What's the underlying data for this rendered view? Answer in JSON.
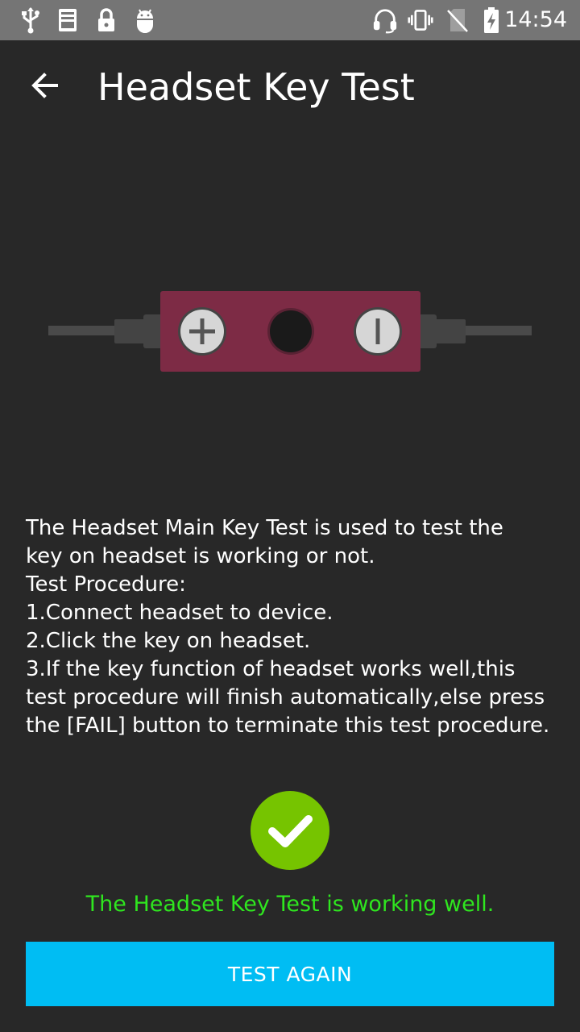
{
  "status_bar": {
    "time": "14:54",
    "icons": [
      "usb-icon",
      "log-icon",
      "lock-icon",
      "android-debug-icon",
      "headset-icon",
      "vibrate-icon",
      "no-sim-icon",
      "battery-charging-icon"
    ]
  },
  "app_bar": {
    "back_icon": "arrow-back-icon",
    "title": "Headset Key Test"
  },
  "illustration": {
    "icon": "headset-remote-icon",
    "remote_color": "#7d2b45",
    "keys": [
      "plus-key-icon",
      "center-key-icon",
      "minus-key-icon"
    ]
  },
  "description": {
    "lines": [
      "The Headset Main Key Test is used to test the",
      "key on headset is working or not.",
      "Test Procedure:",
      "1.Connect headset to device.",
      "2.Click the key on headset.",
      "3.If the key function of headset works well,this",
      "test procedure will finish automatically,else press",
      "the [FAIL] button to terminate this test procedure."
    ]
  },
  "result": {
    "icon": "check-circle-icon",
    "icon_color": "#76c400",
    "message": "The Headset Key Test is working well.",
    "message_color": "#2fe61f"
  },
  "actions": {
    "test_again_label": "TEST AGAIN",
    "button_color": "#00bdf3"
  }
}
